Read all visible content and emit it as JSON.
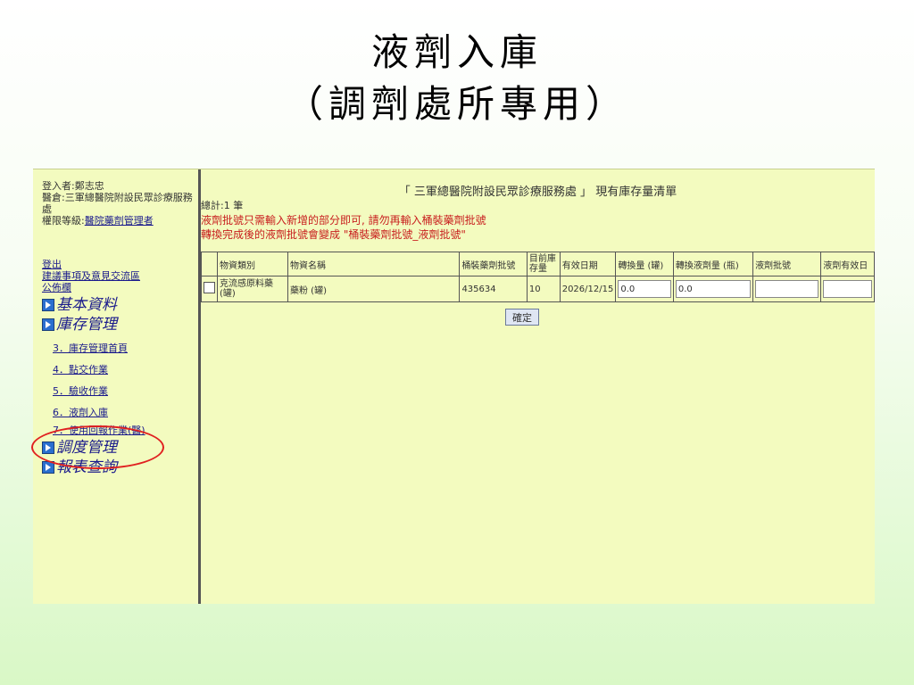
{
  "slide": {
    "title_line1": "液劑入庫",
    "title_line2": "（調劑處所專用）"
  },
  "sidebar": {
    "login_label": "登入者:鄭志忠",
    "warehouse_label": "醫倉:三軍總醫院附設民眾診療服務處",
    "permission_prefix": "權限等級:",
    "permission_value": "醫院藥劑管理者",
    "logout": "登出",
    "suggestions": "建議事項及意見交流區",
    "bulletin": "公佈欄",
    "menu": [
      {
        "label": "基本資料",
        "icon": "play-square-icon"
      },
      {
        "label": "庫存管理",
        "icon": "play-square-icon"
      }
    ],
    "sub_items": [
      "3．庫存管理首頁",
      "4．點交作業",
      "5．驗收作業",
      "6．液劑入庫",
      "7．使用回報作業(醫)"
    ],
    "menu2": [
      {
        "label": "調度管理",
        "icon": "play-square-icon"
      },
      {
        "label": "報表查詢",
        "icon": "play-square-icon"
      }
    ]
  },
  "main": {
    "header": "「 三軍總醫院附設民眾診療服務處 」 現有庫存量清單",
    "total": "總計:1 筆",
    "warning1": "液劑批號只需輸入新增的部分即可, 請勿再輸入桶裝藥劑批號",
    "warning2": "轉換完成後的液劑批號會變成 \"桶裝藥劑批號_液劑批號\"",
    "columns": [
      "物資類別",
      "物資名稱",
      "桶裝藥劑批號",
      "目前庫存量",
      "有效日期",
      "轉換量 (罐)",
      "轉換液劑量 (瓶)",
      "液劑批號",
      "液劑有效日"
    ],
    "row": {
      "category": "克流感原料藥(罐)",
      "name": "藥粉 (罐)",
      "batch": "435634",
      "stock": "10",
      "expiry": "2026/12/15",
      "convert_qty": "0.0",
      "convert_liquid_qty": "0.0",
      "liquid_batch": "",
      "liquid_expiry": ""
    },
    "confirm": "確定"
  },
  "colors": {
    "panel_bg": "#f3fbbf",
    "link": "#1a1a8c",
    "warning": "#c81e1e",
    "highlight_circle": "#e02020"
  }
}
